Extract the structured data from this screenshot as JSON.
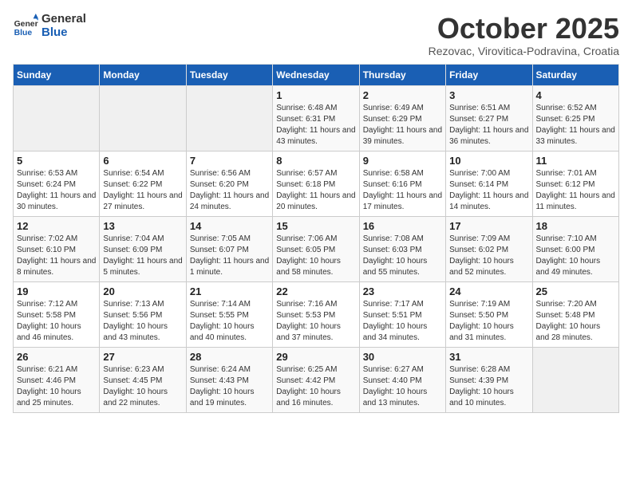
{
  "header": {
    "logo_line1": "General",
    "logo_line2": "Blue",
    "month_title": "October 2025",
    "subtitle": "Rezovac, Virovitica-Podravina, Croatia"
  },
  "days_of_week": [
    "Sunday",
    "Monday",
    "Tuesday",
    "Wednesday",
    "Thursday",
    "Friday",
    "Saturday"
  ],
  "weeks": [
    [
      {
        "day": "",
        "info": ""
      },
      {
        "day": "",
        "info": ""
      },
      {
        "day": "",
        "info": ""
      },
      {
        "day": "1",
        "info": "Sunrise: 6:48 AM\nSunset: 6:31 PM\nDaylight: 11 hours and 43 minutes."
      },
      {
        "day": "2",
        "info": "Sunrise: 6:49 AM\nSunset: 6:29 PM\nDaylight: 11 hours and 39 minutes."
      },
      {
        "day": "3",
        "info": "Sunrise: 6:51 AM\nSunset: 6:27 PM\nDaylight: 11 hours and 36 minutes."
      },
      {
        "day": "4",
        "info": "Sunrise: 6:52 AM\nSunset: 6:25 PM\nDaylight: 11 hours and 33 minutes."
      }
    ],
    [
      {
        "day": "5",
        "info": "Sunrise: 6:53 AM\nSunset: 6:24 PM\nDaylight: 11 hours and 30 minutes."
      },
      {
        "day": "6",
        "info": "Sunrise: 6:54 AM\nSunset: 6:22 PM\nDaylight: 11 hours and 27 minutes."
      },
      {
        "day": "7",
        "info": "Sunrise: 6:56 AM\nSunset: 6:20 PM\nDaylight: 11 hours and 24 minutes."
      },
      {
        "day": "8",
        "info": "Sunrise: 6:57 AM\nSunset: 6:18 PM\nDaylight: 11 hours and 20 minutes."
      },
      {
        "day": "9",
        "info": "Sunrise: 6:58 AM\nSunset: 6:16 PM\nDaylight: 11 hours and 17 minutes."
      },
      {
        "day": "10",
        "info": "Sunrise: 7:00 AM\nSunset: 6:14 PM\nDaylight: 11 hours and 14 minutes."
      },
      {
        "day": "11",
        "info": "Sunrise: 7:01 AM\nSunset: 6:12 PM\nDaylight: 11 hours and 11 minutes."
      }
    ],
    [
      {
        "day": "12",
        "info": "Sunrise: 7:02 AM\nSunset: 6:10 PM\nDaylight: 11 hours and 8 minutes."
      },
      {
        "day": "13",
        "info": "Sunrise: 7:04 AM\nSunset: 6:09 PM\nDaylight: 11 hours and 5 minutes."
      },
      {
        "day": "14",
        "info": "Sunrise: 7:05 AM\nSunset: 6:07 PM\nDaylight: 11 hours and 1 minute."
      },
      {
        "day": "15",
        "info": "Sunrise: 7:06 AM\nSunset: 6:05 PM\nDaylight: 10 hours and 58 minutes."
      },
      {
        "day": "16",
        "info": "Sunrise: 7:08 AM\nSunset: 6:03 PM\nDaylight: 10 hours and 55 minutes."
      },
      {
        "day": "17",
        "info": "Sunrise: 7:09 AM\nSunset: 6:02 PM\nDaylight: 10 hours and 52 minutes."
      },
      {
        "day": "18",
        "info": "Sunrise: 7:10 AM\nSunset: 6:00 PM\nDaylight: 10 hours and 49 minutes."
      }
    ],
    [
      {
        "day": "19",
        "info": "Sunrise: 7:12 AM\nSunset: 5:58 PM\nDaylight: 10 hours and 46 minutes."
      },
      {
        "day": "20",
        "info": "Sunrise: 7:13 AM\nSunset: 5:56 PM\nDaylight: 10 hours and 43 minutes."
      },
      {
        "day": "21",
        "info": "Sunrise: 7:14 AM\nSunset: 5:55 PM\nDaylight: 10 hours and 40 minutes."
      },
      {
        "day": "22",
        "info": "Sunrise: 7:16 AM\nSunset: 5:53 PM\nDaylight: 10 hours and 37 minutes."
      },
      {
        "day": "23",
        "info": "Sunrise: 7:17 AM\nSunset: 5:51 PM\nDaylight: 10 hours and 34 minutes."
      },
      {
        "day": "24",
        "info": "Sunrise: 7:19 AM\nSunset: 5:50 PM\nDaylight: 10 hours and 31 minutes."
      },
      {
        "day": "25",
        "info": "Sunrise: 7:20 AM\nSunset: 5:48 PM\nDaylight: 10 hours and 28 minutes."
      }
    ],
    [
      {
        "day": "26",
        "info": "Sunrise: 6:21 AM\nSunset: 4:46 PM\nDaylight: 10 hours and 25 minutes."
      },
      {
        "day": "27",
        "info": "Sunrise: 6:23 AM\nSunset: 4:45 PM\nDaylight: 10 hours and 22 minutes."
      },
      {
        "day": "28",
        "info": "Sunrise: 6:24 AM\nSunset: 4:43 PM\nDaylight: 10 hours and 19 minutes."
      },
      {
        "day": "29",
        "info": "Sunrise: 6:25 AM\nSunset: 4:42 PM\nDaylight: 10 hours and 16 minutes."
      },
      {
        "day": "30",
        "info": "Sunrise: 6:27 AM\nSunset: 4:40 PM\nDaylight: 10 hours and 13 minutes."
      },
      {
        "day": "31",
        "info": "Sunrise: 6:28 AM\nSunset: 4:39 PM\nDaylight: 10 hours and 10 minutes."
      },
      {
        "day": "",
        "info": ""
      }
    ]
  ]
}
